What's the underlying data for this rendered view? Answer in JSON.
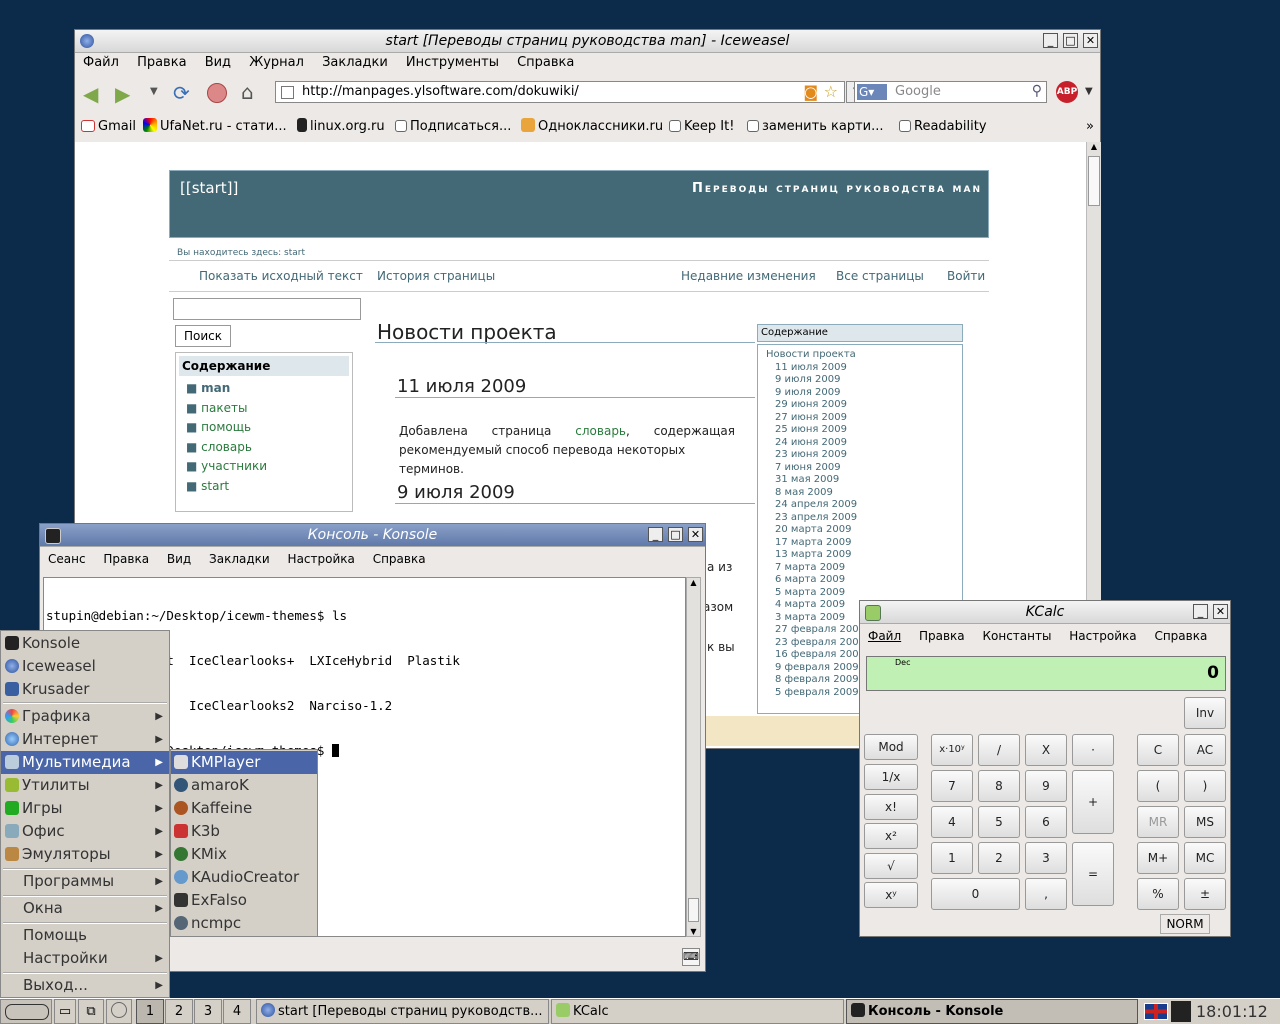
{
  "browser": {
    "title": "start [Переводы страниц руководства man] - Iceweasel",
    "menu": [
      "Файл",
      "Правка",
      "Вид",
      "Журнал",
      "Закладки",
      "Инструменты",
      "Справка"
    ],
    "url": "http://manpages.ylsoftware.com/dokuwiki/",
    "search_placeholder": "Google",
    "bookmarks": [
      "Gmail",
      "UfaNet.ru - стати...",
      "linux.org.ru",
      "Подписаться...",
      "Одноклассники.ru",
      "Keep It!",
      "заменить карти...",
      "Readability"
    ],
    "chevron": "»"
  },
  "page": {
    "header_start": "[[start]]",
    "header_title": "Переводы страниц руководства man",
    "breadcrumb_label": "Вы находитесь здесь:",
    "breadcrumb_link": "start",
    "actions_left": [
      "Показать исходный текст",
      "История страницы"
    ],
    "actions_right": [
      "Недавние изменения",
      "Все страницы",
      "Войти"
    ],
    "search_button": "Поиск",
    "sidebar_title": "Содержание",
    "sidebar_items": [
      "man",
      "пакеты",
      "помощь",
      "словарь",
      "участники",
      "start"
    ],
    "heading": "Новости проекта",
    "h_news1": "11 июля 2009",
    "p_news1_a": "Добавлена",
    "p_news1_b": "страница",
    "p_news1_link": "словарь",
    "p_news1_c": ",",
    "p_news1_d": "содержащая",
    "p_news1_line2": "рекомендуемый способ перевода некоторых терминов.",
    "h_news2": "9 июля 2009",
    "frag1": "а из",
    "frag2": "азом",
    "frag3": "к вы",
    "toc_title": "Содержание",
    "toc_top": "Новости проекта",
    "toc_items": [
      "11 июля 2009",
      "9 июля 2009",
      "9 июля 2009",
      "29 июня 2009",
      "27 июня 2009",
      "25 июня 2009",
      "24 июня 2009",
      "23 июня 2009",
      "7 июня 2009",
      "31 мая 2009",
      "8 мая 2009",
      "24 апреля 2009",
      "23 апреля 2009",
      "20 марта 2009",
      "17 марта 2009",
      "13 марта 2009",
      "7 марта 2009",
      "6 марта 2009",
      "5 марта 2009",
      "4 марта 2009",
      "3 марта 2009",
      "27 февраля 2009",
      "23 февраля 2009",
      "16 февраля 2009",
      "9 февраля 2009",
      "8 февраля 2009",
      "5 февраля 2009"
    ]
  },
  "konsole": {
    "title": "Консоль - Konsole",
    "menu": [
      "Сеанс",
      "Правка",
      "Вид",
      "Закладки",
      "Настройка",
      "Справка"
    ],
    "lines": [
      "stupin@debian:~/Desktop/icewm-themes$ ls",
      "EiskristallDesert  IceClearlooks+  LXIceHybrid  Plastik",
      "IceClearlooks      IceClearlooks2  Narciso-1.2",
      "stupin@debian:~/Desktop/icewm-themes$ "
    ]
  },
  "kcalc": {
    "title": "KCalc",
    "menu": [
      "Файл",
      "Правка",
      "Константы",
      "Настройка",
      "Справка"
    ],
    "mode": "Dec",
    "display": "0",
    "status": "NORM",
    "buttons": {
      "inv": "Inv",
      "mod": "Mod",
      "exp": "x·10ʸ",
      "div": "/",
      "mul": "X",
      "dot_top": "·",
      "c": "C",
      "ac": "AC",
      "inv_x": "1/x",
      "n7": "7",
      "n8": "8",
      "n9": "9",
      "plus": "+",
      "lp": "(",
      "rp": ")",
      "fact": "x!",
      "n4": "4",
      "n5": "5",
      "n6": "6",
      "mr": "MR",
      "ms": "MS",
      "sq": "x²",
      "n1": "1",
      "n2": "2",
      "n3": "3",
      "eq": "=",
      "mplus": "M+",
      "mc": "MC",
      "sqrt": "√",
      "n0": "0",
      "comma": ",",
      "pct": "%",
      "pm": "±",
      "pow": "xʸ"
    }
  },
  "startmenu": {
    "items": [
      "Konsole",
      "Iceweasel",
      "Krusader",
      "Графика",
      "Интернет",
      "Мультимедиа",
      "Утилиты",
      "Игры",
      "Офис",
      "Эмуляторы",
      "Программы",
      "Окна",
      "Помощь",
      "Настройки",
      "Выход..."
    ],
    "submenu": [
      "KMPlayer",
      "amaroK",
      "Kaffeine",
      "K3b",
      "KMix",
      "KAudioCreator",
      "ExFalso",
      "ncmpc"
    ]
  },
  "taskbar": {
    "workspaces": [
      "1",
      "2",
      "3",
      "4"
    ],
    "tasks": [
      "start [Переводы страниц руководств...",
      "KCalc",
      "Консоль - Konsole"
    ],
    "clock": "18:01:12"
  }
}
